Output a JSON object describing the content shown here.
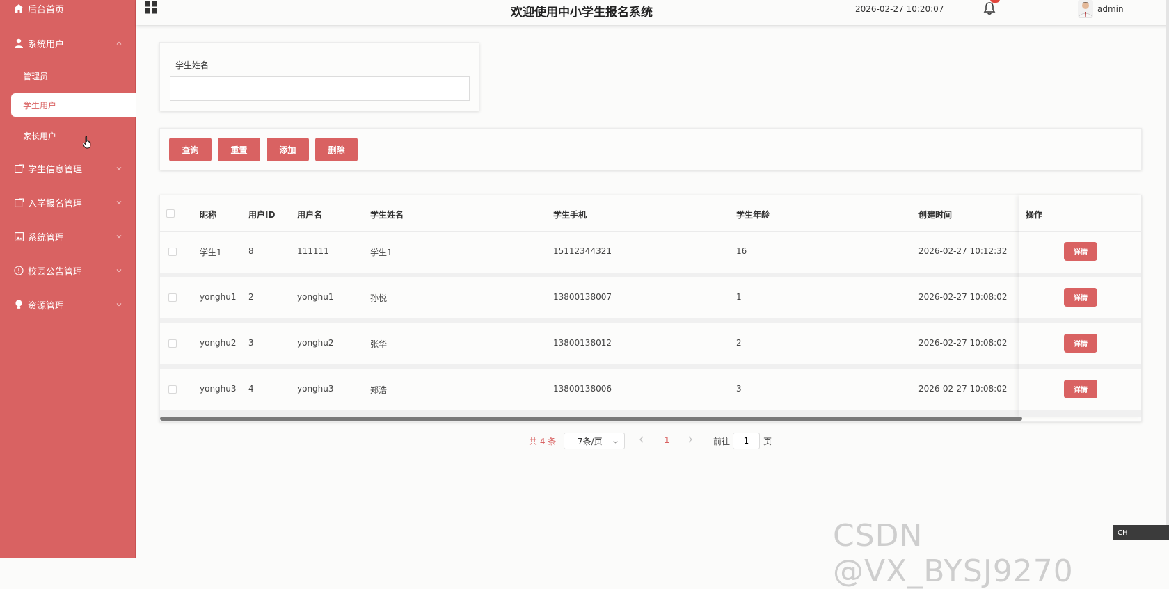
{
  "sidebar": {
    "home": "后台首页",
    "system_users": "系统用户",
    "sub_items": [
      "管理员",
      "学生用户",
      "家长用户"
    ],
    "student_info": "学生信息管理",
    "enrollment": "入学报名管理",
    "system_mgmt": "系统管理",
    "announcement": "校园公告管理",
    "resources": "资源管理"
  },
  "header": {
    "title": "欢迎使用中小学生报名系统",
    "datetime": "2026-02-27 10:20:07",
    "username": "admin"
  },
  "search": {
    "label": "学生姓名",
    "value": ""
  },
  "toolbar": {
    "query": "查询",
    "reset": "重置",
    "add": "添加",
    "delete": "删除"
  },
  "table": {
    "columns": [
      "昵称",
      "用户ID",
      "用户名",
      "学生姓名",
      "学生手机",
      "学生年龄",
      "创建时间",
      "操作"
    ],
    "rows": [
      {
        "nickname": "学生1",
        "id": "8",
        "username": "111111",
        "name": "学生1",
        "phone": "15112344321",
        "age": "16",
        "created": "2026-02-27 10:12:32"
      },
      {
        "nickname": "yonghu1",
        "id": "2",
        "username": "yonghu1",
        "name": "孙悦",
        "phone": "13800138007",
        "age": "1",
        "created": "2026-02-27 10:08:02"
      },
      {
        "nickname": "yonghu2",
        "id": "3",
        "username": "yonghu2",
        "name": "张华",
        "phone": "13800138012",
        "age": "2",
        "created": "2026-02-27 10:08:02"
      },
      {
        "nickname": "yonghu3",
        "id": "4",
        "username": "yonghu3",
        "name": "郑浩",
        "phone": "13800138006",
        "age": "3",
        "created": "2026-02-27 10:08:02"
      }
    ],
    "detail_label": "详情"
  },
  "pagination": {
    "total": "共 4 条",
    "page_size": "7条/页",
    "current_page": "1",
    "goto_label": "前往",
    "goto_value": "1",
    "page_suffix": "页"
  },
  "watermark": "CSDN @VX_BYSJ9270",
  "ime": "CH",
  "colors": {
    "primary": "#d96262",
    "background": "#fbfbfa"
  }
}
